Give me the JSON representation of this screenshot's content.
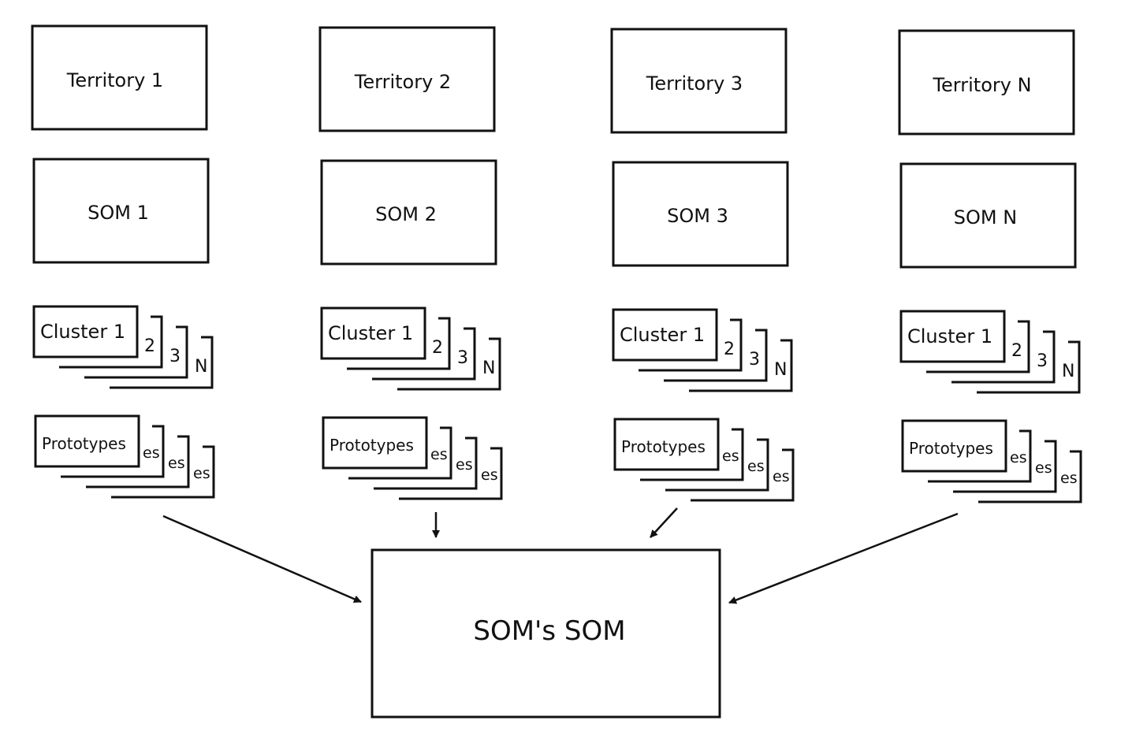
{
  "columns": [
    {
      "territory": "Territory 1",
      "som": "SOM 1",
      "clusters": [
        "Cluster 1",
        "2",
        "3",
        "N"
      ],
      "prototypes": [
        "Prototypes",
        "es",
        "es",
        "es"
      ]
    },
    {
      "territory": "Territory 2",
      "som": "SOM 2",
      "clusters": [
        "Cluster 1",
        "2",
        "3",
        "N"
      ],
      "prototypes": [
        "Prototypes",
        "es",
        "es",
        "es"
      ]
    },
    {
      "territory": "Territory 3",
      "som": "SOM 3",
      "clusters": [
        "Cluster 1",
        "2",
        "3",
        "N"
      ],
      "prototypes": [
        "Prototypes",
        "es",
        "es",
        "es"
      ]
    },
    {
      "territory": "Territory N",
      "som": "SOM N",
      "clusters": [
        "Cluster 1",
        "2",
        "3",
        "N"
      ],
      "prototypes": [
        "Prototypes",
        "es",
        "es",
        "es"
      ]
    }
  ],
  "target": {
    "label": "SOM's SOM"
  }
}
